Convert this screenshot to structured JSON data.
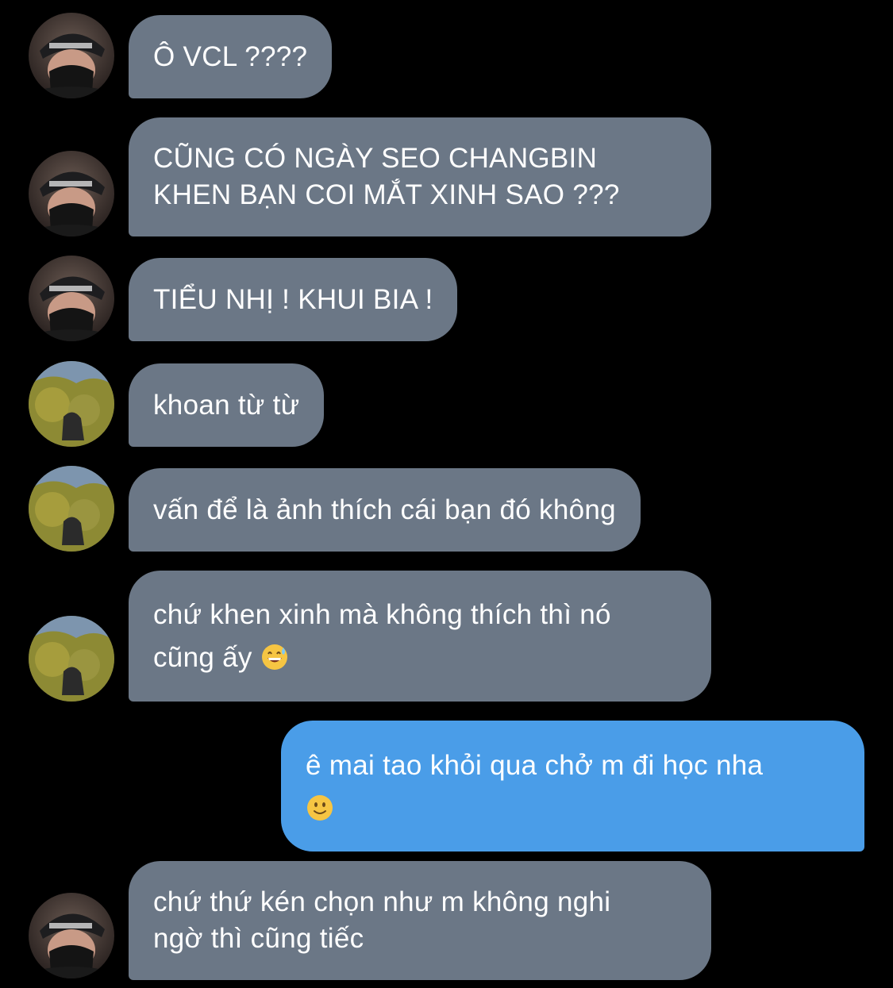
{
  "messages": [
    {
      "sender": "friend-a",
      "text": "Ô VCL ????"
    },
    {
      "sender": "friend-a",
      "text": "CŨNG CÓ NGÀY SEO CHANGBIN\nKHEN BẠN COI MẮT XINH SAO ???"
    },
    {
      "sender": "friend-a",
      "text": "TIỂU NHỊ ! KHUI BIA !"
    },
    {
      "sender": "friend-b",
      "text": "khoan từ từ"
    },
    {
      "sender": "friend-b",
      "text": "vấn để là ảnh thích cái bạn đó không"
    },
    {
      "sender": "friend-b",
      "text": "chứ khen xinh mà không thích thì nó\ncũng ấy ",
      "emoji": "grinning-sweat-emoji"
    },
    {
      "sender": "me",
      "text": "ê mai tao khỏi qua chở m đi học nha\n",
      "emoji": "slightly-smiling-emoji"
    },
    {
      "sender": "friend-a",
      "text": "chứ thứ kén chọn như m không nghi\nngờ thì cũng tiếc"
    }
  ],
  "colors": {
    "background": "#000000",
    "incoming_bubble": "#6b7786",
    "outgoing_bubble": "#4a9de8",
    "text": "#ffffff"
  },
  "avatars": {
    "friend-a": "masked-cap-avatar",
    "friend-b": "tree-photo-avatar"
  }
}
